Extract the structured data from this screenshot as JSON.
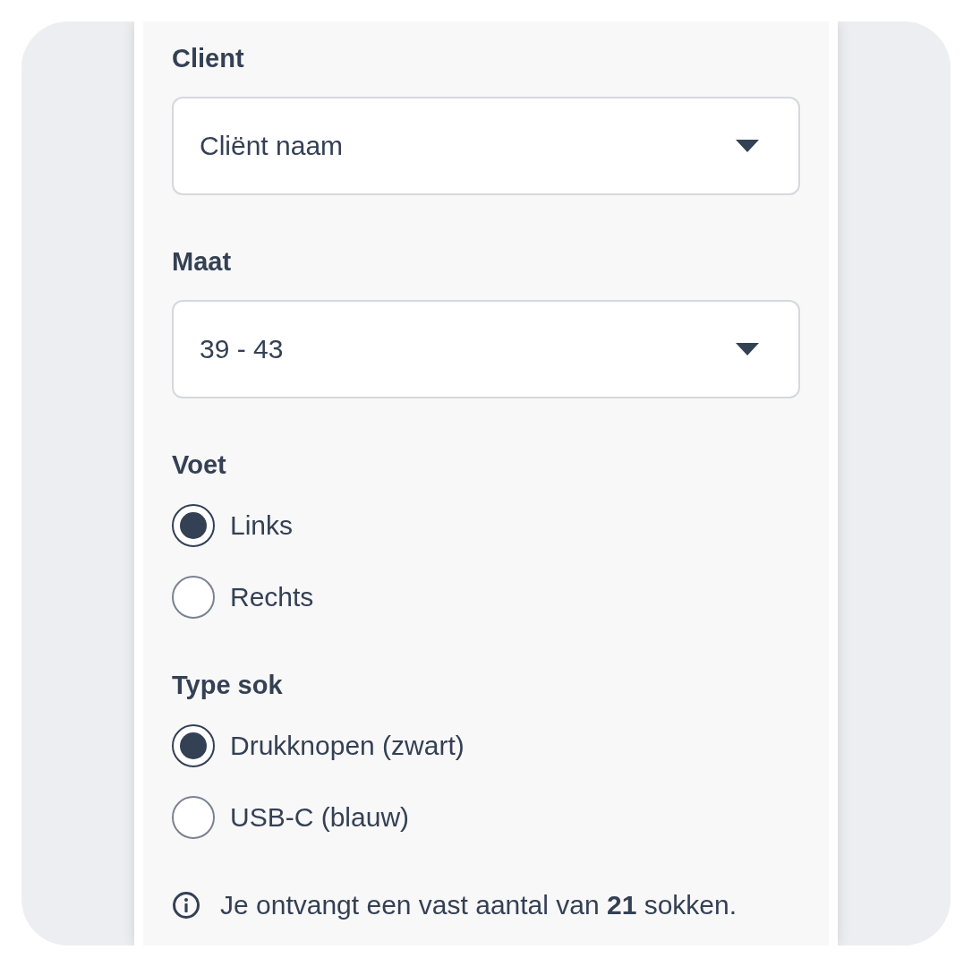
{
  "fields": [
    {
      "kind": "select",
      "label": "Client",
      "value": "Cliënt naam"
    },
    {
      "kind": "select",
      "label": "Maat",
      "value": "39 - 43"
    },
    {
      "kind": "radio",
      "label": "Voet",
      "options": [
        {
          "label": "Links",
          "selected": true
        },
        {
          "label": "Rechts",
          "selected": false
        }
      ]
    },
    {
      "kind": "radio",
      "label": "Type sok",
      "options": [
        {
          "label": "Drukknopen (zwart)",
          "selected": true
        },
        {
          "label": "USB-C (blauw)",
          "selected": false
        }
      ]
    }
  ],
  "note": "Je ontvangt een vast aantal van **21** sokken."
}
